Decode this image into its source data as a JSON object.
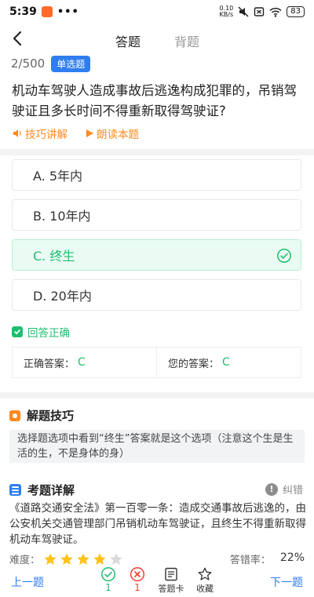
{
  "status": {
    "time": "5:39",
    "dots": "•••",
    "network": "0.10\nKB/s",
    "battery": "83"
  },
  "nav": {
    "tab_active": "答题",
    "tab_inactive": "背题"
  },
  "question": {
    "progress": "2/500",
    "type": "单选题",
    "text": "机动车驾驶人造成事故后逃逸构成犯罪的，吊销驾驶证且多长时间不得重新取得驾驶证?",
    "skill_link": "技巧讲解",
    "read_link": "朗读本题"
  },
  "options": [
    {
      "label": "A. 5年内"
    },
    {
      "label": "B. 10年内"
    },
    {
      "label": "C. 终生"
    },
    {
      "label": "D. 20年内"
    }
  ],
  "result": {
    "text": "回答正确",
    "correct_label": "正确答案：",
    "correct_value": "C",
    "your_label": "您的答案：",
    "your_value": "C"
  },
  "tips": {
    "title": "解题技巧",
    "text": "选择题选项中看到“终生”答案就是这个选项（注意这个生是生活的生，不是身体的身）"
  },
  "detail": {
    "title": "考题详解",
    "report": "纠错",
    "text": "《道路交通安全法》第一百零一条：造成交通事故后逃逸的，由公安机关交通管理部门吊销机动车驾驶证，且终生不得重新取得机动车驾驶证。",
    "difficulty_label": "难度：",
    "difficulty_stars": 4,
    "error_rate_label": "答错率：",
    "error_rate": "22%"
  },
  "bottom": {
    "prev": "上一题",
    "next": "下一题",
    "correct_count": "1",
    "wrong_count": "1",
    "card": "答题卡",
    "favorite": "收藏"
  },
  "colors": {
    "accent": "#2e7ef0",
    "correct": "#1fbd70",
    "wrong": "#ff3b30",
    "orange": "#ff8a1f"
  }
}
